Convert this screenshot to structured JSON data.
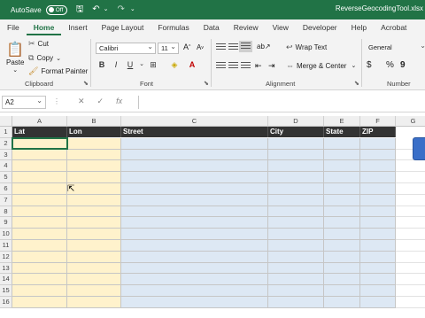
{
  "titlebar": {
    "autosave_label": "AutoSave",
    "autosave_state": "Off",
    "filename": "ReverseGeocodingTool.xlsx"
  },
  "tabs": [
    "File",
    "Home",
    "Insert",
    "Page Layout",
    "Formulas",
    "Data",
    "Review",
    "View",
    "Developer",
    "Help",
    "Acrobat"
  ],
  "active_tab": "Home",
  "ribbon": {
    "clipboard": {
      "paste": "Paste",
      "cut": "Cut",
      "copy": "Copy",
      "format_painter": "Format Painter",
      "label": "Clipboard"
    },
    "font": {
      "font_name": "Calibri",
      "font_size": "11",
      "bold": "B",
      "italic": "I",
      "underline": "U",
      "label": "Font"
    },
    "alignment": {
      "wrap_text": "Wrap Text",
      "merge_center": "Merge & Center",
      "label": "Alignment"
    },
    "number": {
      "format": "General",
      "currency": "$",
      "percent": "%",
      "label": "Number"
    }
  },
  "formula_bar": {
    "name_box": "A2",
    "fx": "fx",
    "content": ""
  },
  "columns": [
    "A",
    "B",
    "C",
    "D",
    "E",
    "F",
    "G"
  ],
  "rows": [
    "1",
    "2",
    "3",
    "4",
    "5",
    "6",
    "7",
    "8",
    "9",
    "10",
    "11",
    "12",
    "13",
    "14",
    "15",
    "16"
  ],
  "header_row": [
    "Lat",
    "Lon",
    "Street",
    "City",
    "State",
    "ZIP"
  ],
  "colors": {
    "excel_green": "#217346",
    "header_dark": "#333333",
    "latlon_fill": "#fff2cc",
    "address_fill": "#dde8f4"
  }
}
